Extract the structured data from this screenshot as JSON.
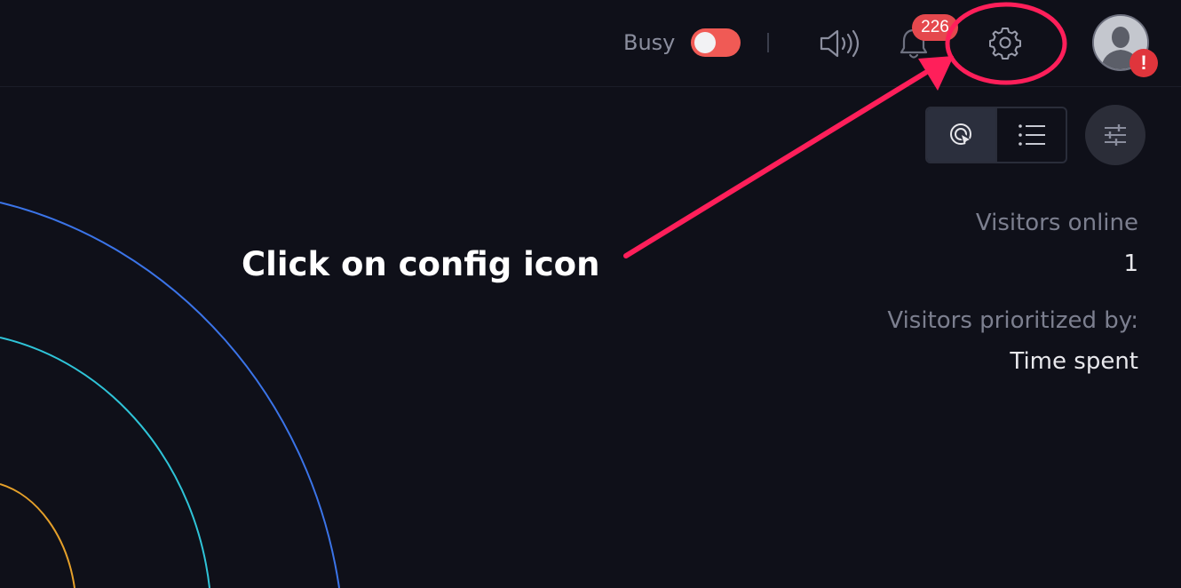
{
  "header": {
    "busy_label": "Busy",
    "busy_on": true,
    "notification_count": "226",
    "avatar_alert": "!"
  },
  "stats": {
    "visitors_online_label": "Visitors online",
    "visitors_online_value": "1",
    "prioritized_label": "Visitors prioritized by:",
    "prioritized_value": "Time spent"
  },
  "annotation": {
    "text": "Click on config icon",
    "color": "#ff1f5a"
  },
  "icons": {
    "sound": "speaker-waves-icon",
    "bell": "bell-icon",
    "gear": "gear-icon",
    "radar": "radar-icon",
    "list": "list-icon",
    "filter": "sliders-icon"
  },
  "colors": {
    "background": "#0f1019",
    "toggle_on": "#f05a55",
    "badge": "#e5484d",
    "orbit_blue": "#3b74e8",
    "orbit_cyan": "#2fc4d8",
    "orbit_orange": "#e5a02a"
  }
}
